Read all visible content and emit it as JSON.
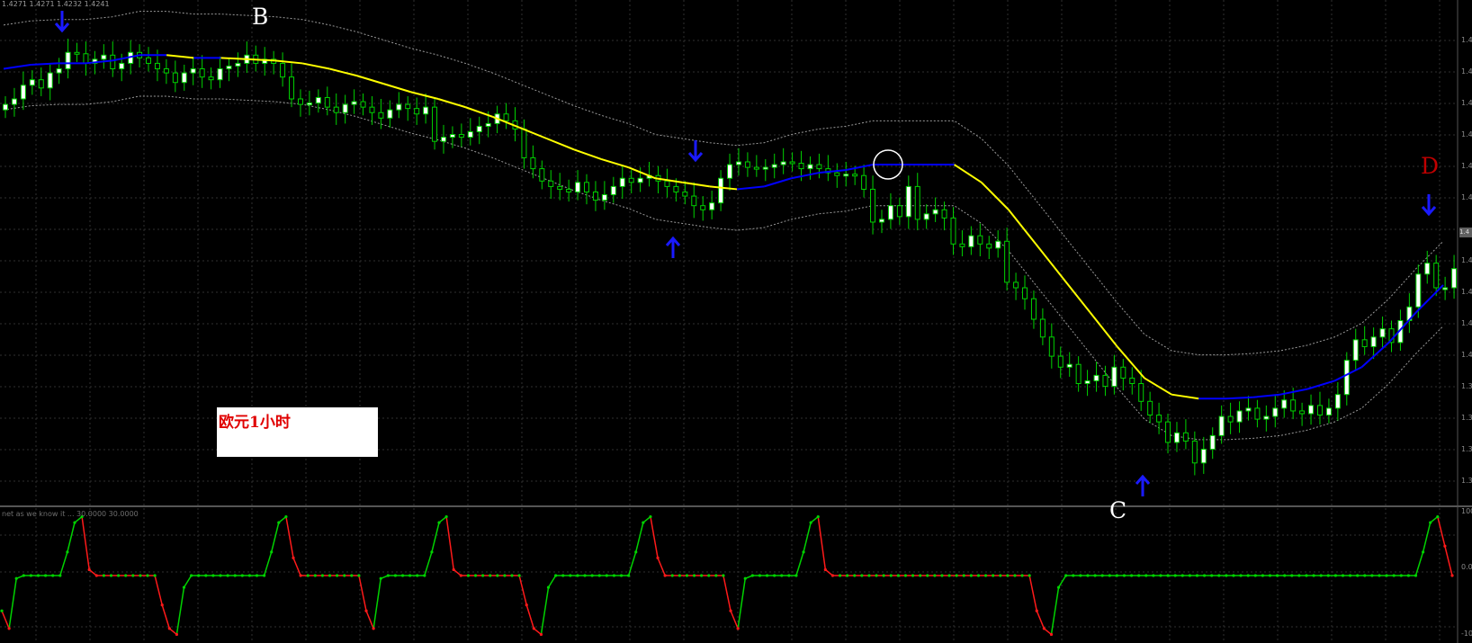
{
  "header": {
    "ohlc": "1.4271 1.4271 1.4232 1.4241"
  },
  "indicator": {
    "subtitle": "net as we know it ... 30.0000 30.0000"
  },
  "note": {
    "text": "欧元1小时"
  },
  "labels": {
    "b": "B",
    "c": "C",
    "d": "D"
  },
  "colors": {
    "background": "#000000",
    "grid": "#2f2f2f",
    "bull_candle": "#00d200",
    "bull_body": "#ffffff",
    "ma_down": "#ffff00",
    "ma_up": "#0000ff",
    "bands": "#9a9a9a",
    "arrow": "#1a1aff",
    "osc_up": "#00d200",
    "osc_down": "#ff1a1a",
    "label_b": "#ffffff",
    "label_c": "#ffffff",
    "label_d": "#c00000"
  },
  "chart_data": [
    {
      "type": "candlestick",
      "title": "",
      "y_ticks": [
        "1.4",
        "1.4",
        "1.4",
        "1.4",
        "1.4",
        "1.4",
        "1.4",
        "1.4",
        "1.4",
        "1.4",
        "1.3",
        "1.3",
        "1.3",
        "1.3"
      ],
      "price_tag": "1.4",
      "close": [
        1.4232,
        1.4236,
        1.4246,
        1.425,
        1.4244,
        1.4255,
        1.4258,
        1.427,
        1.4269,
        1.4262,
        1.4265,
        1.4268,
        1.4258,
        1.4262,
        1.427,
        1.4266,
        1.4262,
        1.4258,
        1.4255,
        1.4248,
        1.4255,
        1.4258,
        1.4252,
        1.425,
        1.4258,
        1.426,
        1.4262,
        1.4268,
        1.4262,
        1.4265,
        1.4262,
        1.4252,
        1.4236,
        1.4232,
        1.4233,
        1.4237,
        1.423,
        1.4226,
        1.4232,
        1.4234,
        1.423,
        1.4226,
        1.4222,
        1.4228,
        1.4232,
        1.4229,
        1.4225,
        1.423,
        1.4205,
        1.4208,
        1.421,
        1.4208,
        1.4212,
        1.4216,
        1.4218,
        1.4225,
        1.422,
        1.4214,
        1.4193,
        1.4185,
        1.4176,
        1.4172,
        1.417,
        1.4168,
        1.4175,
        1.4168,
        1.4162,
        1.4166,
        1.4172,
        1.4178,
        1.4175,
        1.4178,
        1.418,
        1.4176,
        1.4172,
        1.4168,
        1.4165,
        1.4158,
        1.4155,
        1.416,
        1.4178,
        1.4188,
        1.419,
        1.4186,
        1.4185,
        1.4186,
        1.4188,
        1.419,
        1.4189,
        1.4185,
        1.4188,
        1.4185,
        1.4182,
        1.418,
        1.4181,
        1.418,
        1.417,
        1.4146,
        1.4148,
        1.4158,
        1.415,
        1.4172,
        1.4148,
        1.4152,
        1.4155,
        1.4149,
        1.413,
        1.4128,
        1.4136,
        1.413,
        1.4127,
        1.4132,
        1.4102,
        1.4098,
        1.409,
        1.4075,
        1.4062,
        1.4048,
        1.404,
        1.4042,
        1.4028,
        1.403,
        1.4034,
        1.4026,
        1.404,
        1.4032,
        1.4028,
        1.4015,
        1.4005,
        1.4,
        1.3985,
        1.3992,
        1.3986,
        1.397,
        1.398,
        1.399,
        1.4004,
        1.4,
        1.4008,
        1.401,
        1.4002,
        1.4004,
        1.401,
        1.4016,
        1.4008,
        1.4006,
        1.4012,
        1.4005,
        1.401,
        1.402,
        1.4045,
        1.406,
        1.4055,
        1.4062,
        1.4068,
        1.4058,
        1.4074,
        1.4084,
        1.4108,
        1.4116,
        1.4098,
        1.4098,
        1.4112
      ],
      "moving_average": [
        1.4258,
        1.4261,
        1.4262,
        1.4262,
        1.4264,
        1.4268,
        1.4268,
        1.4266,
        1.4266,
        1.4265,
        1.4264,
        1.4262,
        1.4258,
        1.4253,
        1.4247,
        1.4241,
        1.4236,
        1.423,
        1.4223,
        1.4215,
        1.4207,
        1.4199,
        1.4192,
        1.4186,
        1.4178,
        1.4175,
        1.4172,
        1.417,
        1.4172,
        1.4178,
        1.4182,
        1.4184,
        1.4188,
        1.4188,
        1.4188,
        1.4188,
        1.4175,
        1.4155,
        1.413,
        1.4105,
        1.408,
        1.4055,
        1.4032,
        1.402,
        1.4017,
        1.4017,
        1.4018,
        1.402,
        1.4024,
        1.403,
        1.404,
        1.4058,
        1.408,
        1.41
      ],
      "ylim": [
        1.396,
        1.4282
      ]
    },
    {
      "type": "line",
      "title": "",
      "y_ticks": [
        "100",
        "0.0",
        "-10"
      ],
      "values": [
        -60,
        -90,
        -5,
        0,
        0,
        0,
        0,
        0,
        0,
        40,
        90,
        100,
        10,
        0,
        0,
        0,
        0,
        0,
        0,
        0,
        0,
        0,
        -50,
        -90,
        -100,
        -20,
        0,
        0,
        0,
        0,
        0,
        0,
        0,
        0,
        0,
        0,
        0,
        40,
        90,
        100,
        30,
        0,
        0,
        0,
        0,
        0,
        0,
        0,
        0,
        0,
        -60,
        -90,
        -5,
        0,
        0,
        0,
        0,
        0,
        0,
        40,
        90,
        100,
        10,
        0,
        0,
        0,
        0,
        0,
        0,
        0,
        0,
        0,
        -50,
        -90,
        -100,
        -20,
        0,
        0,
        0,
        0,
        0,
        0,
        0,
        0,
        0,
        0,
        0,
        40,
        90,
        100,
        30,
        0,
        0,
        0,
        0,
        0,
        0,
        0,
        0,
        0,
        -60,
        -90,
        -5,
        0,
        0,
        0,
        0,
        0,
        0,
        0,
        40,
        90,
        100,
        10,
        0,
        0,
        0,
        0,
        0,
        0,
        0,
        0,
        0,
        0,
        0,
        0,
        0,
        0,
        0,
        0,
        0,
        0,
        0,
        0,
        0,
        0,
        0,
        0,
        0,
        0,
        0,
        0,
        -60,
        -90,
        -100,
        -20,
        0,
        0,
        0,
        0,
        0,
        0,
        0,
        0,
        0,
        0,
        0,
        0,
        0,
        0,
        0,
        0,
        0,
        0,
        0,
        0,
        0,
        0,
        0,
        0,
        0,
        0,
        0,
        0,
        0,
        0,
        0,
        0,
        0,
        0,
        0,
        0,
        0,
        0,
        0,
        0,
        0,
        0,
        0,
        0,
        0,
        0,
        0,
        0,
        0,
        40,
        90,
        100,
        50,
        0
      ],
      "ylim": [
        -110,
        110
      ]
    }
  ]
}
